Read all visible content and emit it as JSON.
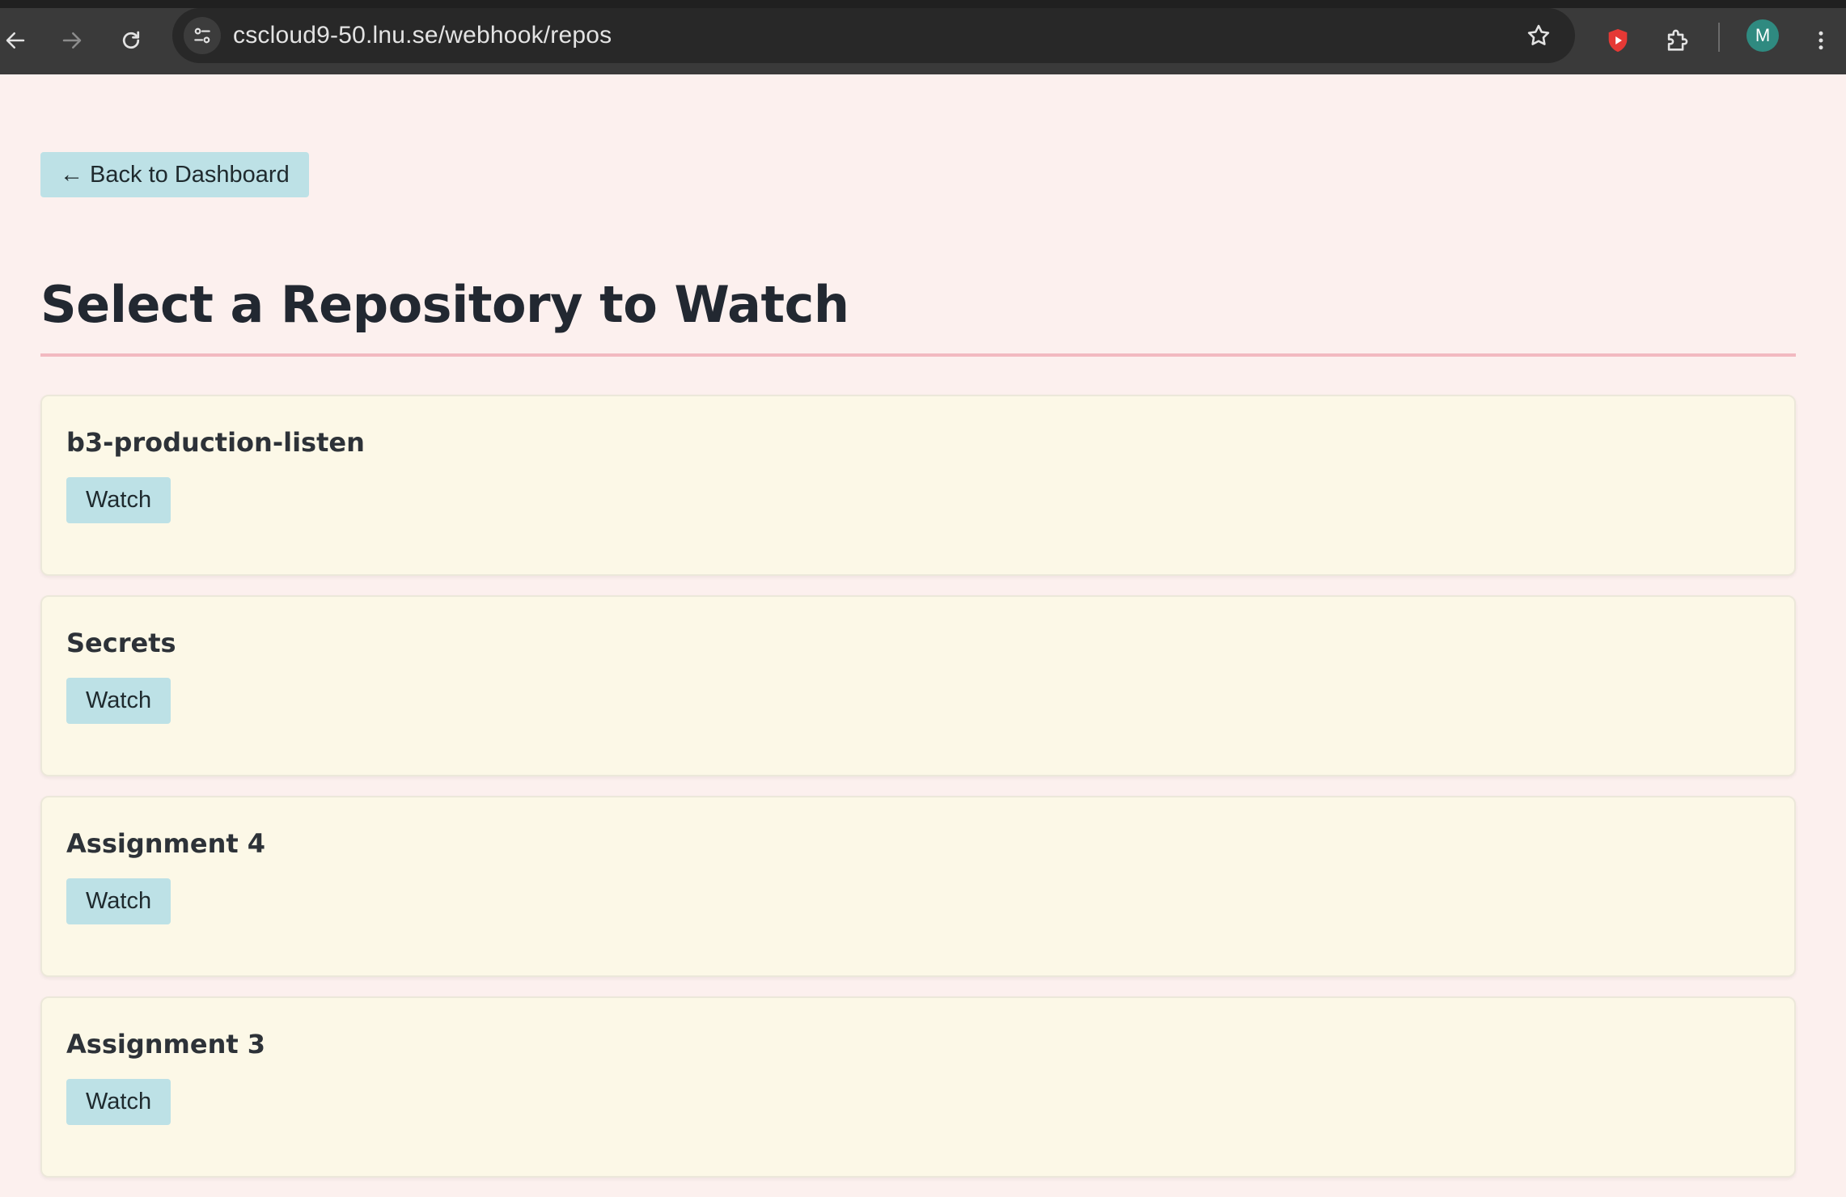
{
  "browser": {
    "url": "cscloud9-50.lnu.se/webhook/repos",
    "profile_initial": "M",
    "icons": {
      "back": "arrow-left-icon",
      "forward": "arrow-right-icon",
      "reload": "reload-icon",
      "site_info": "tune-icon",
      "bookmark": "star-icon",
      "extension_shield": "shield-play-icon",
      "extensions": "puzzle-icon",
      "menu": "kebab-menu-icon"
    },
    "colors": {
      "shield": "#e53935",
      "avatar": "#2f8a80"
    }
  },
  "page": {
    "back_label": "← Back to Dashboard",
    "title": "Select a Repository to Watch",
    "watch_label": "Watch",
    "repos": [
      {
        "name": "b3-production-listen"
      },
      {
        "name": "Secrets"
      },
      {
        "name": "Assignment 4"
      },
      {
        "name": "Assignment 3"
      }
    ],
    "colors": {
      "background": "#fcf0ee",
      "card": "#fcf8e7",
      "button": "#bde1e6",
      "title_rule": "#f2b9c0"
    }
  }
}
